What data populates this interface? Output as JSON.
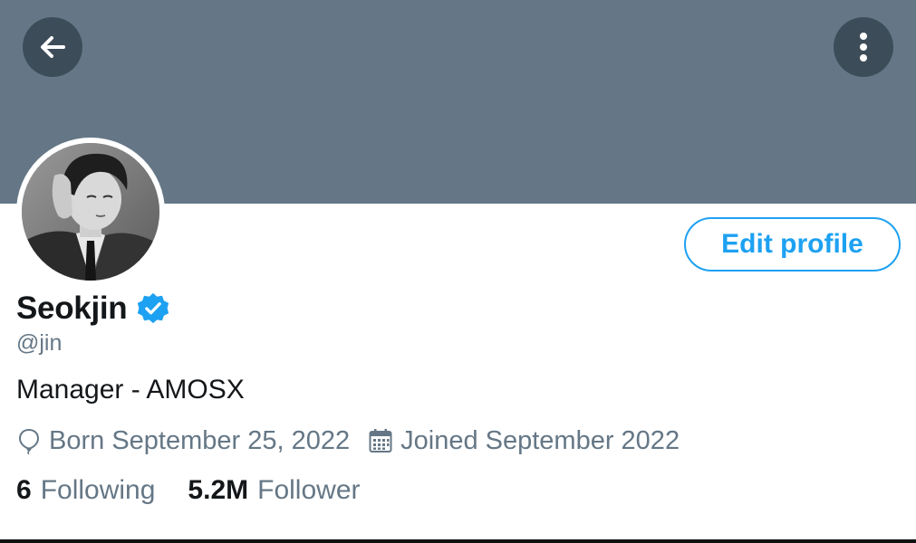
{
  "header": {
    "back_icon": "arrow-left-icon",
    "more_icon": "vertical-dots-icon",
    "banner_color": "#657786"
  },
  "profile": {
    "display_name": "Seokjin",
    "verified": true,
    "handle": "@jin",
    "bio": "Manager - AMOSX",
    "born_text": "Born September 25, 2022",
    "joined_text": "Joined September 2022",
    "edit_button_label": "Edit profile"
  },
  "stats": {
    "following_count": "6",
    "following_label": "Following",
    "followers_count": "5.2M",
    "followers_label": "Follower"
  },
  "colors": {
    "accent": "#1da1f2",
    "secondary_text": "#657786",
    "primary_text": "#14171a"
  }
}
